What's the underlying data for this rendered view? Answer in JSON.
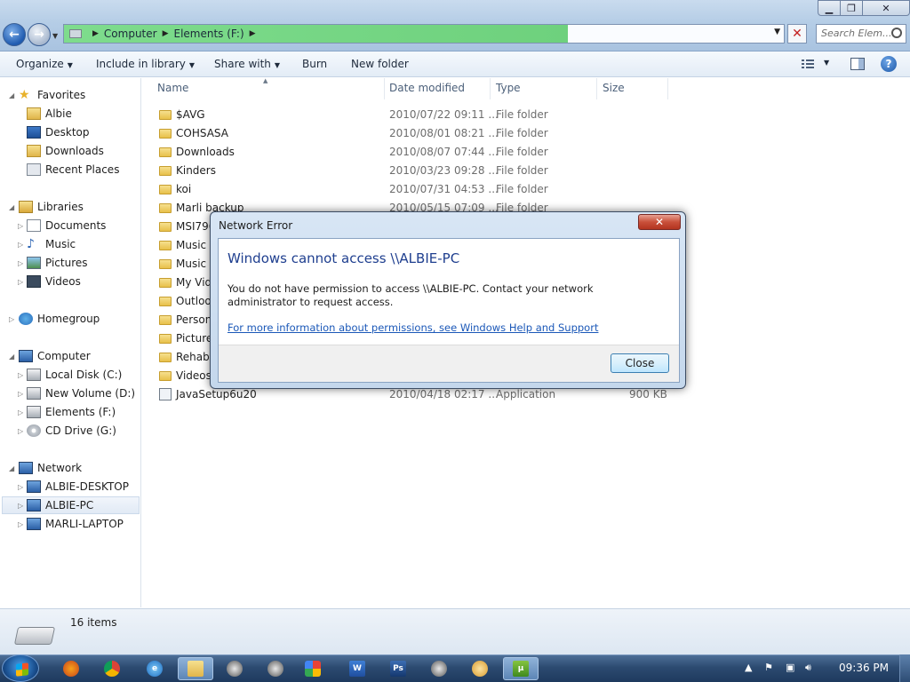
{
  "address_bar": {
    "crumbs": [
      "Computer",
      "Elements (F:)"
    ],
    "search_placeholder": "Search Elem..."
  },
  "command_bar": {
    "organize": "Organize",
    "include_in_library": "Include in library",
    "share_with": "Share with",
    "burn": "Burn",
    "new_folder": "New folder"
  },
  "nav_pane": {
    "favorites": {
      "label": "Favorites",
      "items": [
        "Albie",
        "Desktop",
        "Downloads",
        "Recent Places"
      ]
    },
    "libraries": {
      "label": "Libraries",
      "items": [
        "Documents",
        "Music",
        "Pictures",
        "Videos"
      ]
    },
    "homegroup": "Homegroup",
    "computer": {
      "label": "Computer",
      "items": [
        "Local Disk (C:)",
        "New Volume (D:)",
        "Elements (F:)",
        "CD Drive (G:)"
      ]
    },
    "network": {
      "label": "Network",
      "items": [
        "ALBIE-DESKTOP",
        "ALBIE-PC",
        "MARLI-LAPTOP"
      ],
      "selected": "ALBIE-PC"
    }
  },
  "columns": {
    "name": "Name",
    "date_modified": "Date modified",
    "type": "Type",
    "size": "Size"
  },
  "files": [
    {
      "name": "$AVG",
      "date": "2010/07/22 09:11 ...",
      "type": "File folder",
      "size": ""
    },
    {
      "name": "COHSASA",
      "date": "2010/08/01 08:21 ...",
      "type": "File folder",
      "size": ""
    },
    {
      "name": "Downloads",
      "date": "2010/08/07 07:44 ...",
      "type": "File folder",
      "size": ""
    },
    {
      "name": "Kinders",
      "date": "2010/03/23 09:28 ...",
      "type": "File folder",
      "size": ""
    },
    {
      "name": "koi",
      "date": "2010/07/31 04:53 ...",
      "type": "File folder",
      "size": ""
    },
    {
      "name": "Marli backup",
      "date": "2010/05/15 07:09 ...",
      "type": "File folder",
      "size": ""
    },
    {
      "name": "MSI796",
      "date": "",
      "type": "",
      "size": ""
    },
    {
      "name": "Music",
      "date": "",
      "type": "",
      "size": ""
    },
    {
      "name": "Music D",
      "date": "",
      "type": "",
      "size": ""
    },
    {
      "name": "My Vid",
      "date": "",
      "type": "",
      "size": ""
    },
    {
      "name": "Outloo",
      "date": "",
      "type": "",
      "size": ""
    },
    {
      "name": "Persona",
      "date": "",
      "type": "",
      "size": ""
    },
    {
      "name": "Pictures",
      "date": "",
      "type": "",
      "size": ""
    },
    {
      "name": "Rehab",
      "date": "",
      "type": "",
      "size": ""
    },
    {
      "name": "Videos",
      "date": "",
      "type": "",
      "size": ""
    },
    {
      "name": "JavaSetup6u20",
      "date": "2010/04/18 02:17 ...",
      "type": "Application",
      "size": "900 KB"
    }
  ],
  "details": {
    "item_count": "16 items"
  },
  "dialog": {
    "title": "Network Error",
    "close_glyph": "✕",
    "heading": "Windows cannot access \\\\ALBIE-PC",
    "message": "You do not have permission to access \\\\ALBIE-PC. Contact your network administrator to request access.",
    "link": "For more information about permissions, see Windows Help and Support",
    "button": "Close"
  },
  "taskbar": {
    "clock": "09:36 PM",
    "apps": [
      "firefox-icon",
      "chrome-icon",
      "ie-icon",
      "explorer-icon",
      "app-icon",
      "app-icon",
      "picasa-icon",
      "word-icon",
      "photoshop-icon",
      "app-icon",
      "paint-icon",
      "utorrent-icon"
    ]
  }
}
